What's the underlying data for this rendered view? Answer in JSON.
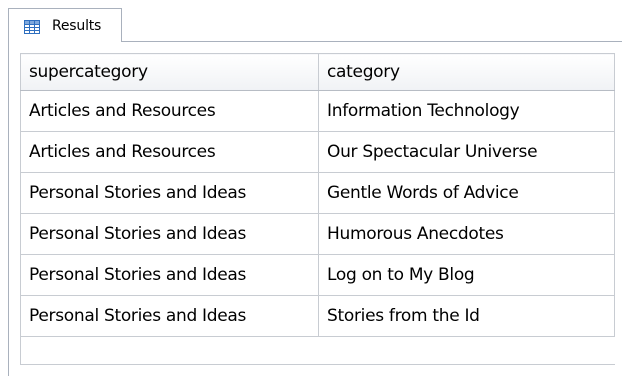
{
  "tab": {
    "label": "Results",
    "icon": "grid-icon"
  },
  "grid": {
    "columns": [
      "supercategory",
      "category"
    ],
    "rows": [
      [
        "Articles and Resources",
        "Information Technology"
      ],
      [
        "Articles and Resources",
        "Our Spectacular Universe"
      ],
      [
        "Personal Stories and Ideas",
        "Gentle Words of Advice"
      ],
      [
        "Personal Stories and Ideas",
        "Humorous Anecdotes"
      ],
      [
        "Personal Stories and Ideas",
        "Log on to My Blog"
      ],
      [
        "Personal Stories and Ideas",
        "Stories from the Id"
      ]
    ]
  },
  "colors": {
    "tab_border": "#a9b1bd",
    "grid_line": "#c8ccd2",
    "icon_blue": "#2f6fbf"
  }
}
